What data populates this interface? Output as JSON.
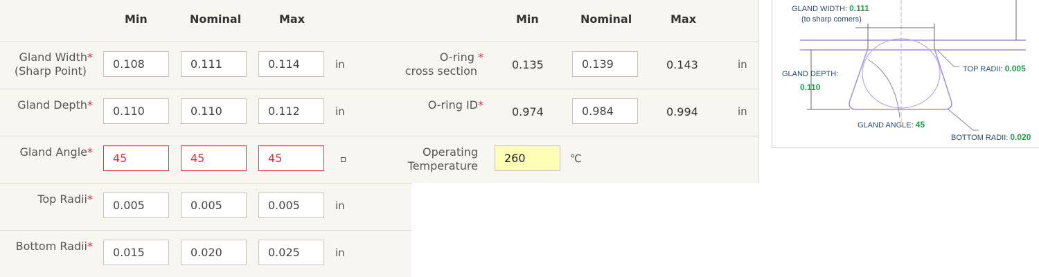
{
  "headers": {
    "min": "Min",
    "nominal": "Nominal",
    "max": "Max"
  },
  "gland": {
    "width": {
      "label1": "Gland Width",
      "label2": "(Sharp Point)",
      "req": "*",
      "min": "0.108",
      "nominal": "0.111",
      "max": "0.114",
      "unit": "in"
    },
    "depth": {
      "label": "Gland Depth",
      "req": "*",
      "min": "0.110",
      "nominal": "0.110",
      "max": "0.112",
      "unit": "in"
    },
    "angle": {
      "label": "Gland Angle",
      "req": "*",
      "min": "45",
      "nominal": "45",
      "max": "45"
    },
    "top_radii": {
      "label": "Top Radii",
      "req": "*",
      "min": "0.005",
      "nominal": "0.005",
      "max": "0.005",
      "unit": "in"
    },
    "bottom_radii": {
      "label": "Bottom Radii",
      "req": "*",
      "min": "0.015",
      "nominal": "0.020",
      "max": "0.025",
      "unit": "in"
    }
  },
  "oring": {
    "cross_section": {
      "label1": "O-ring",
      "req": "*",
      "label2": "cross section",
      "min": "0.135",
      "nominal": "0.139",
      "max": "0.143",
      "unit": "in"
    },
    "id": {
      "label": "O-ring ID",
      "req": "*",
      "min": "0.974",
      "nominal": "0.984",
      "max": "0.994",
      "unit": "in"
    },
    "temp": {
      "label1": "Operating",
      "label2": "Temperature",
      "value": "260",
      "unit": "℃"
    }
  },
  "diagram": {
    "gland_width_label": "GLAND WIDTH:",
    "gland_width_value": "0.111",
    "sharp_corners": "(to sharp corners)",
    "gland_depth_label": "GLAND DEPTH:",
    "gland_depth_value": "0.110",
    "top_radii_label": "TOP RADII:",
    "top_radii_value": "0.005",
    "gland_angle_label": "GLAND ANGLE:",
    "gland_angle_value": "45",
    "bottom_radii_label": "BOTTOM RADII:",
    "bottom_radii_value": "0.020"
  },
  "colors": {
    "required": "#d9363e",
    "error": "#e0323d",
    "highlight": "#fdfdb3",
    "diagram_value": "#1e9e4a",
    "diagram_line": "#9b8fe0"
  }
}
